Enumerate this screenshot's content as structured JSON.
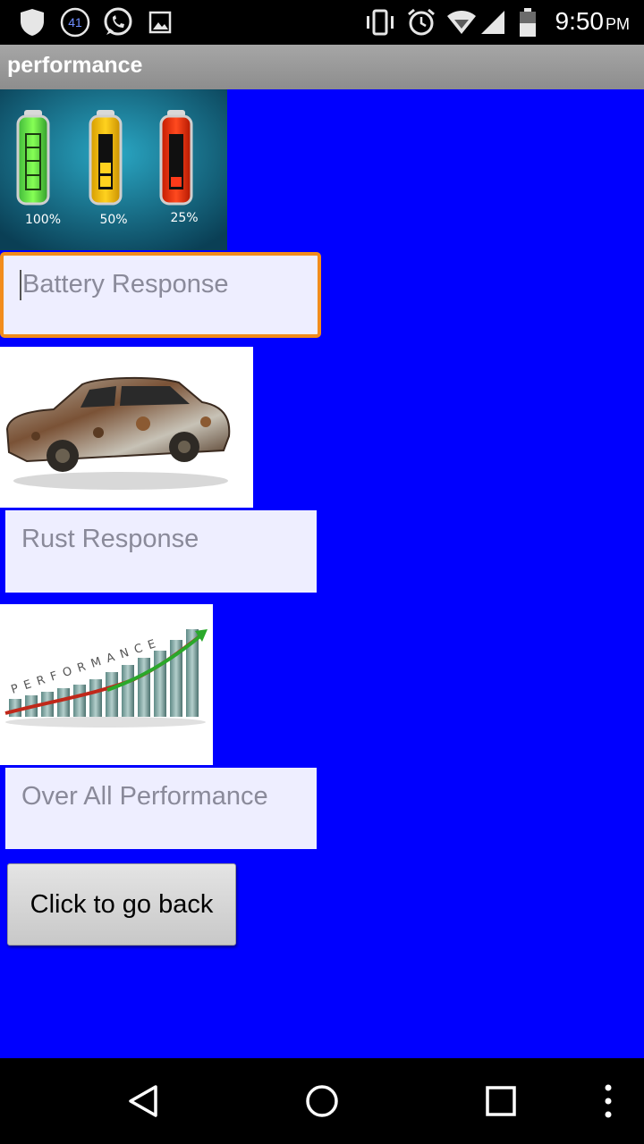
{
  "status_bar": {
    "notification_count": "41",
    "time": "9:50",
    "ampm": "PM",
    "left_icons": [
      "shield-icon",
      "notification-count-icon",
      "whatsapp-icon",
      "image-icon"
    ],
    "right_icons": [
      "vibrate-icon",
      "alarm-icon",
      "wifi-icon",
      "signal-icon",
      "battery-icon"
    ]
  },
  "app_bar": {
    "title": "performance"
  },
  "battery_image": {
    "labels": [
      "100%",
      "50%",
      "25%"
    ]
  },
  "fields": {
    "battery_response": {
      "placeholder": "Battery Response"
    },
    "rust_response": {
      "placeholder": "Rust Response"
    },
    "overall_performance": {
      "placeholder": "Over All Performance"
    }
  },
  "performance_image": {
    "text": "PERFORMANCE"
  },
  "back_button": {
    "label": "Click to go back"
  },
  "nav_bar": {
    "icons": [
      "back-icon",
      "home-icon",
      "recents-icon",
      "more-icon"
    ]
  },
  "colors": {
    "background": "#0000FF",
    "focus_border": "#F28C1B",
    "field_bg": "#EEEEFF"
  }
}
